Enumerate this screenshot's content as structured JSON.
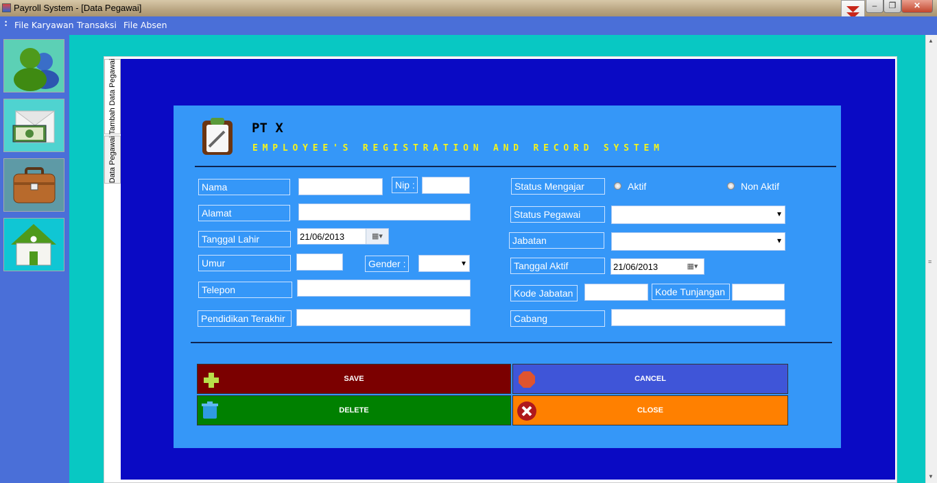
{
  "window": {
    "title": "Payroll System - [Data Pegawai]",
    "minimize": "–",
    "restore": "❐",
    "close": "✕"
  },
  "menu": [
    "File Karyawan",
    "Transaksi",
    "File Absen"
  ],
  "nav_icons": [
    "users-icon",
    "money-envelope-icon",
    "briefcase-icon",
    "home-icon"
  ],
  "tabs": [
    "Tambah Data Pegawai",
    "Data Pegawai"
  ],
  "header": {
    "company": "PT X",
    "subtitle": "EMPLOYEE'S REGISTRATION AND RECORD SYSTEM"
  },
  "form_left": {
    "nama": "Nama",
    "nip": "Nip :",
    "alamat": "Alamat",
    "tanggal_lahir": "Tanggal Lahir",
    "tanggal_lahir_value": "21/06/2013",
    "umur": "Umur",
    "gender": "Gender :",
    "telepon": "Telepon",
    "pendidikan": "Pendidikan Terakhir"
  },
  "form_right": {
    "status_mengajar": "Status Mengajar",
    "aktif": "Aktif",
    "non_aktif": "Non Aktif",
    "status_pegawai": "Status Pegawai",
    "jabatan": "Jabatan",
    "tanggal_aktif": "Tanggal Aktif",
    "tanggal_aktif_value": "21/06/2013",
    "kode_jabatan": "Kode Jabatan",
    "kode_tunjangan": "Kode Tunjangan",
    "cabang": "Cabang"
  },
  "buttons": {
    "save": "SAVE",
    "cancel": "CANCEL",
    "delete": "DELETE",
    "close": "CLOSE"
  },
  "colors": {
    "save": "#7b0000",
    "cancel": "#3f55d8",
    "delete": "#008000",
    "close": "#ff8000",
    "panel": "#3597f8",
    "pane": "#0a0ac4",
    "mdi": "#08c8c3"
  }
}
